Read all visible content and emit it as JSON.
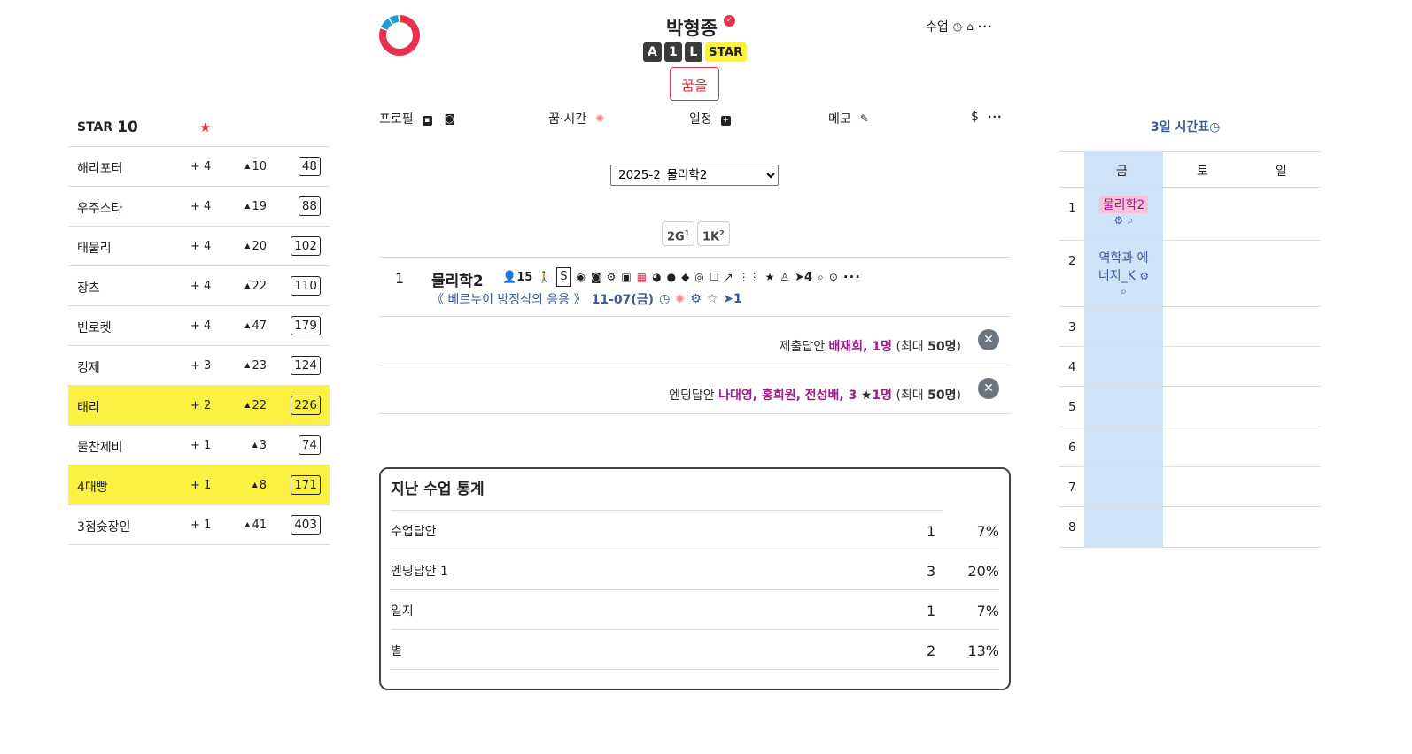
{
  "header": {
    "user_name": "박형종",
    "badges": [
      "A",
      "1",
      "L"
    ],
    "star_badge": "STAR",
    "dream_button": "꿈을",
    "top_right_label": "수업",
    "more": "···"
  },
  "tabs": {
    "profile": "프로필",
    "dream_time": "꿈·시간",
    "schedule": "일정",
    "memo": "메모",
    "dollar": "$",
    "more": "···"
  },
  "star_panel": {
    "title": "STAR",
    "count": "10",
    "rows": [
      {
        "name": "해리포터",
        "plus": "+ 4",
        "up": "10",
        "total": "48",
        "highlight": false
      },
      {
        "name": "우주스타",
        "plus": "+ 4",
        "up": "19",
        "total": "88",
        "highlight": false
      },
      {
        "name": "태물리",
        "plus": "+ 4",
        "up": "20",
        "total": "102",
        "highlight": false
      },
      {
        "name": "장츠",
        "plus": "+ 4",
        "up": "22",
        "total": "110",
        "highlight": false
      },
      {
        "name": "빈로켓",
        "plus": "+ 4",
        "up": "47",
        "total": "179",
        "highlight": false
      },
      {
        "name": "킹제",
        "plus": "+ 3",
        "up": "23",
        "total": "124",
        "highlight": false
      },
      {
        "name": "태리",
        "plus": "+ 2",
        "up": "22",
        "total": "226",
        "highlight": true
      },
      {
        "name": "물찬제비",
        "plus": "+ 1",
        "up": "3",
        "total": "74",
        "highlight": false
      },
      {
        "name": "4대빵",
        "plus": "+ 1",
        "up": "8",
        "total": "171",
        "highlight": true
      },
      {
        "name": "3점슛장인",
        "plus": "+ 1",
        "up": "41",
        "total": "403",
        "highlight": false
      }
    ],
    "highlight_color": "#fbf142"
  },
  "course_select": {
    "value": "2025-2_물리학2"
  },
  "chips": [
    {
      "main": "2G",
      "sup": "1"
    },
    {
      "main": "1K",
      "sup": "2"
    }
  ],
  "class_row": {
    "number": "1",
    "title": "물리학2",
    "person_count": "15",
    "s_label": "S",
    "share_count": "4",
    "lesson": "《 베르누이 방정식의 응용 》",
    "date": "11-07(금)",
    "arrow_count": "1"
  },
  "answers": {
    "submit_label": "제출답안",
    "submit_names": "배재희, 1명",
    "submit_max_prefix": "(최대 ",
    "submit_max": "50명",
    "submit_max_suffix": ")",
    "ending_label": "엔딩답안",
    "ending_names": "나대영, 홍희원, 전성배, 3",
    "ending_star": "1명",
    "ending_max_prefix": "(최대 ",
    "ending_max": "50명",
    "ending_max_suffix": ")"
  },
  "stats": {
    "title": "지난 수업 통계",
    "rows": [
      {
        "label": "수업답안",
        "count": "1",
        "pct": "7%"
      },
      {
        "label": "엔딩답안 1",
        "count": "3",
        "pct": "20%"
      },
      {
        "label": "일지",
        "count": "1",
        "pct": "7%"
      },
      {
        "label": "별",
        "count": "2",
        "pct": "13%"
      }
    ]
  },
  "timetable": {
    "title": "3일 시간표",
    "days": [
      "금",
      "토",
      "일"
    ],
    "periods": [
      "1",
      "2",
      "3",
      "4",
      "5",
      "6",
      "7",
      "8"
    ],
    "cells": {
      "p1": "물리학2",
      "p2_line1": "역학과 에",
      "p2_line2": "너지_K"
    }
  },
  "colors": {
    "accent_blue": "#3d5a9a",
    "highlight_yellow": "#fbf142",
    "timetable_col": "#cfe3f8",
    "name_purple": "#a01a87",
    "red": "#e8314d"
  }
}
